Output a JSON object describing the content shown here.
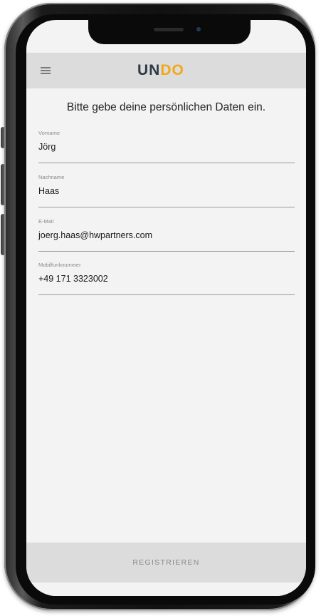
{
  "header": {
    "menu_icon": "hamburger-menu-icon",
    "logo": {
      "part1": "UN",
      "part2": "DO",
      "brand_dark": "#2f3a46",
      "brand_gold": "#f2a81a"
    }
  },
  "form": {
    "intro": "Bitte gebe deine persönlichen Daten ein.",
    "fields": [
      {
        "label": "Vorname",
        "value": "Jörg"
      },
      {
        "label": "Nachname",
        "value": "Haas"
      },
      {
        "label": "E-Mail",
        "value": "joerg.haas@hwpartners.com"
      },
      {
        "label": "Mobilfunknummer",
        "value": "+49 171 3323002"
      }
    ]
  },
  "footer": {
    "register_label": "REGISTRIEREN"
  }
}
